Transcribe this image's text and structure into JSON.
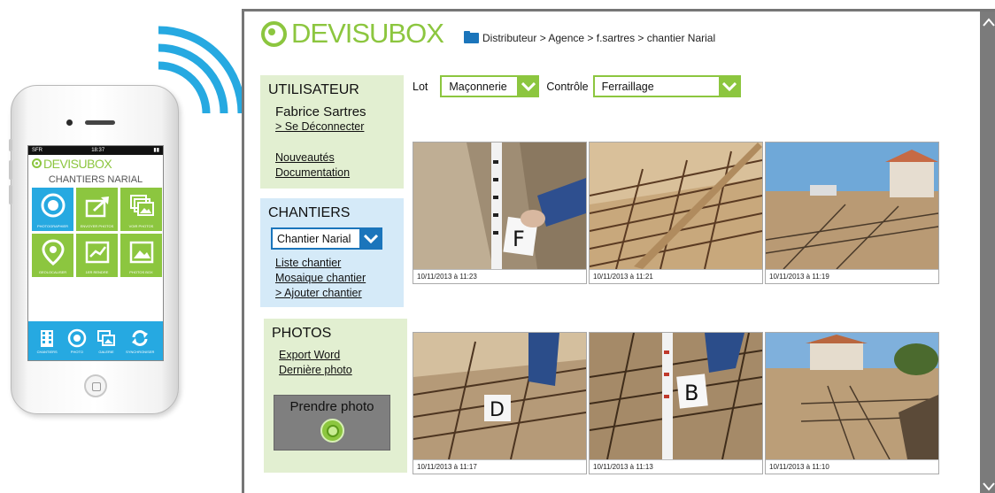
{
  "phone": {
    "status_left": "SFR",
    "status_time": "18:37",
    "app_name": "DEVISUBOX",
    "screen_title": "CHANTIERS NARIAL",
    "tiles": [
      {
        "label": "PHOTOGRAPHIER",
        "icon": "camera-icon",
        "color": "blue"
      },
      {
        "label": "ENVOYER PHOTOS",
        "icon": "send-icon",
        "color": "green"
      },
      {
        "label": "VOIR PHOTOS",
        "icon": "photos-icon",
        "color": "green"
      },
      {
        "label": "GEOLOCALISER",
        "icon": "pin-icon",
        "color": "green"
      },
      {
        "label": "1ER RENDRE",
        "icon": "chart-icon",
        "color": "green"
      },
      {
        "label": "PHOTOS BOX",
        "icon": "image-icon",
        "color": "green"
      }
    ],
    "bottom_nav": [
      "CHANTIERS",
      "PHOTO",
      "GALERIE",
      "SYNCHRONISER"
    ]
  },
  "header": {
    "app_name": "DEVISUBOX",
    "breadcrumb": "Distributeur > Agence > f.sartres > chantier Narial"
  },
  "user": {
    "section_title": "UTILISATEUR",
    "name": "Fabrice Sartres",
    "logout": "> Se Déconnecter",
    "news": "Nouveautés",
    "docs": "Documentation"
  },
  "chantiers": {
    "section_title": "CHANTIERS",
    "selected": "Chantier Narial",
    "list": "Liste chantier",
    "mosaic": "Mosaique chantier",
    "add": "> Ajouter chantier"
  },
  "photos": {
    "section_title": "PHOTOS",
    "export": "Export Word",
    "last": "Dernière photo",
    "take": "Prendre photo"
  },
  "filters": {
    "lot_label": "Lot",
    "lot_value": "Maçonnerie",
    "controle_label": "Contrôle",
    "controle_value": "Ferraillage"
  },
  "gallery": [
    {
      "caption": "10/11/2013 à 11:23",
      "marker": "F"
    },
    {
      "caption": "10/11/2013 à 11:21",
      "marker": ""
    },
    {
      "caption": "10/11/2013 à 11:19",
      "marker": ""
    },
    {
      "caption": "10/11/2013 à 11:17",
      "marker": "D"
    },
    {
      "caption": "10/11/2013 à 11:13",
      "marker": "B"
    },
    {
      "caption": "10/11/2013 à 11:10",
      "marker": ""
    }
  ],
  "colors": {
    "brand_green": "#8cc63f",
    "brand_blue": "#1b75bb",
    "phone_blue": "#26a9e1"
  }
}
